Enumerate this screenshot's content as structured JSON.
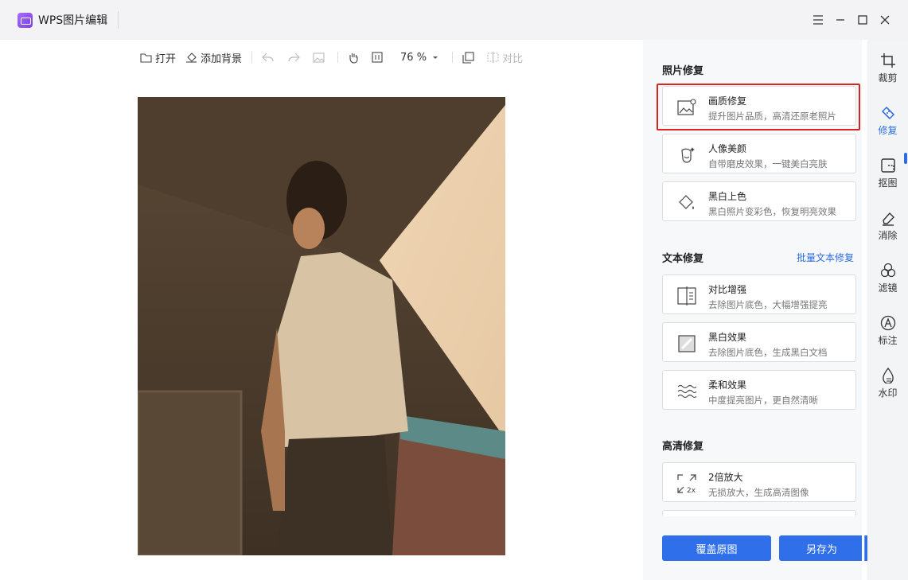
{
  "app": {
    "title": "WPS图片编辑"
  },
  "toolbar": {
    "open": "打开",
    "add_background": "添加背景",
    "zoom": "76 %",
    "compare": "对比"
  },
  "panel": {
    "photo_repair": {
      "title": "照片修复",
      "cards": [
        {
          "title": "画质修复",
          "desc": "提升图片品质，高清还原老照片"
        },
        {
          "title": "人像美颜",
          "desc": "自带磨皮效果，一键美白亮肤"
        },
        {
          "title": "黑白上色",
          "desc": "黑白照片变彩色，恢复明亮效果"
        }
      ]
    },
    "text_repair": {
      "title": "文本修复",
      "batch_link": "批量文本修复",
      "cards": [
        {
          "title": "对比增强",
          "desc": "去除图片底色，大幅增强提亮"
        },
        {
          "title": "黑白效果",
          "desc": "去除图片底色，生成黑白文档"
        },
        {
          "title": "柔和效果",
          "desc": "中度提亮图片，更自然清晰"
        }
      ]
    },
    "hd_repair": {
      "title": "高清修复",
      "cards": [
        {
          "title": "2倍放大",
          "desc": "无损放大，生成高清图像",
          "icon_text": "2x"
        }
      ]
    },
    "buttons": {
      "overwrite": "覆盖原图",
      "save_as": "另存为"
    }
  },
  "sidebar": {
    "items": [
      {
        "label": "裁剪",
        "icon": "crop-icon"
      },
      {
        "label": "修复",
        "icon": "repair-icon",
        "active": true
      },
      {
        "label": "抠图",
        "icon": "cutout-icon"
      },
      {
        "label": "消除",
        "icon": "eraser-icon"
      },
      {
        "label": "滤镜",
        "icon": "filter-icon"
      },
      {
        "label": "标注",
        "icon": "annotate-icon"
      },
      {
        "label": "水印",
        "icon": "watermark-icon"
      }
    ]
  },
  "colors": {
    "accent": "#2f6fe9",
    "highlight": "#dd2222",
    "titlebar_bg": "#f3f3f5"
  }
}
